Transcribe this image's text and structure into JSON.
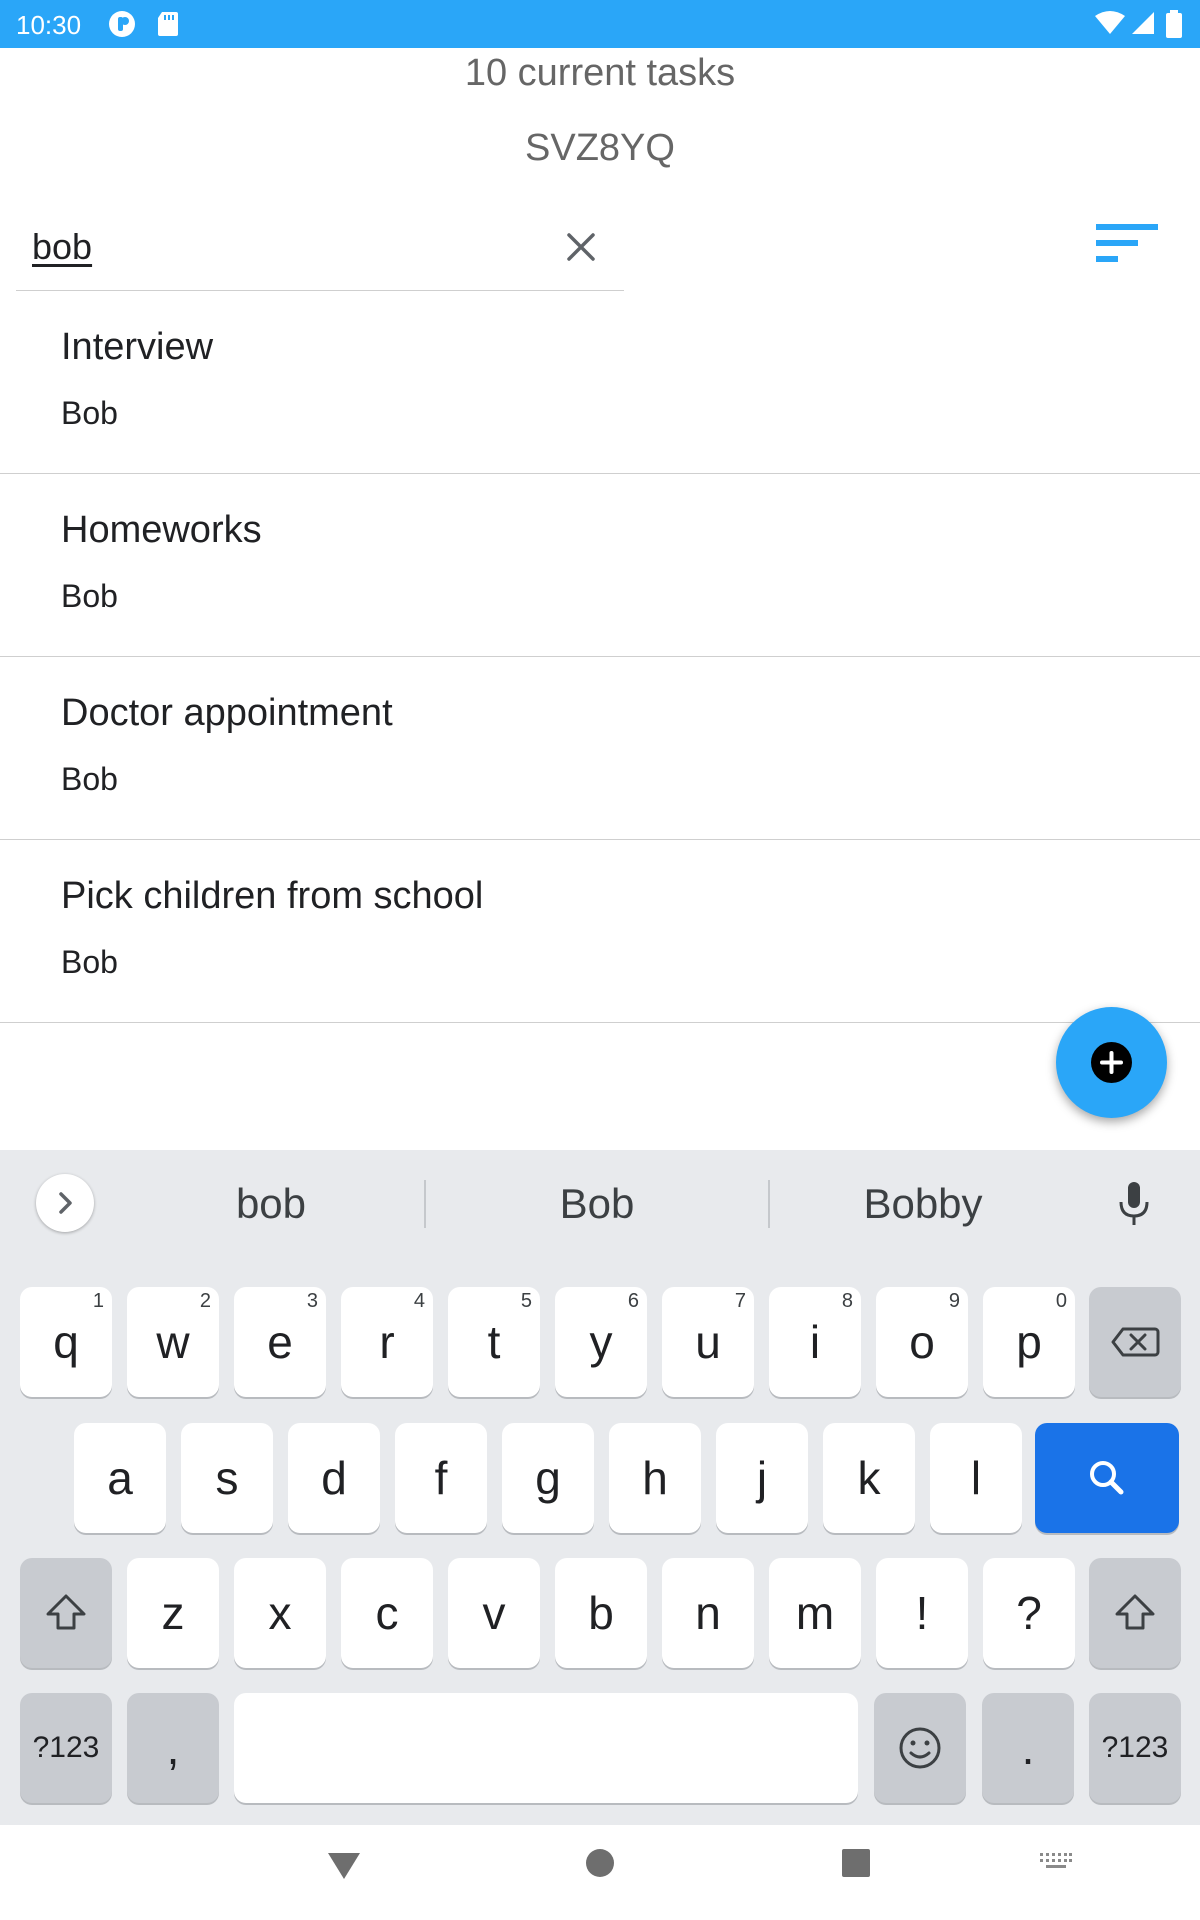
{
  "status_bar": {
    "time": "10:30",
    "color": "#2aa6f8"
  },
  "header": {
    "task_count": "10 current tasks",
    "room_code": "SVZ8YQ"
  },
  "search": {
    "value": "bob"
  },
  "tasks": [
    {
      "title": "Interview",
      "owner": "Bob"
    },
    {
      "title": "Homeworks",
      "owner": "Bob"
    },
    {
      "title": "Doctor appointment",
      "owner": "Bob"
    },
    {
      "title": "Pick children from school",
      "owner": "Bob"
    }
  ],
  "keyboard": {
    "suggestions": [
      "bob",
      "Bob",
      "Bobby"
    ],
    "row1": [
      {
        "k": "q",
        "h": "1"
      },
      {
        "k": "w",
        "h": "2"
      },
      {
        "k": "e",
        "h": "3"
      },
      {
        "k": "r",
        "h": "4"
      },
      {
        "k": "t",
        "h": "5"
      },
      {
        "k": "y",
        "h": "6"
      },
      {
        "k": "u",
        "h": "7"
      },
      {
        "k": "i",
        "h": "8"
      },
      {
        "k": "o",
        "h": "9"
      },
      {
        "k": "p",
        "h": "0"
      }
    ],
    "row2": [
      "a",
      "s",
      "d",
      "f",
      "g",
      "h",
      "j",
      "k",
      "l"
    ],
    "row3": [
      "z",
      "x",
      "c",
      "v",
      "b",
      "n",
      "m",
      "!",
      "?"
    ],
    "symbols_label": "?123",
    "comma": ",",
    "period": "."
  },
  "accent_color": "#2aa6f8",
  "search_key_color": "#1a73e8"
}
